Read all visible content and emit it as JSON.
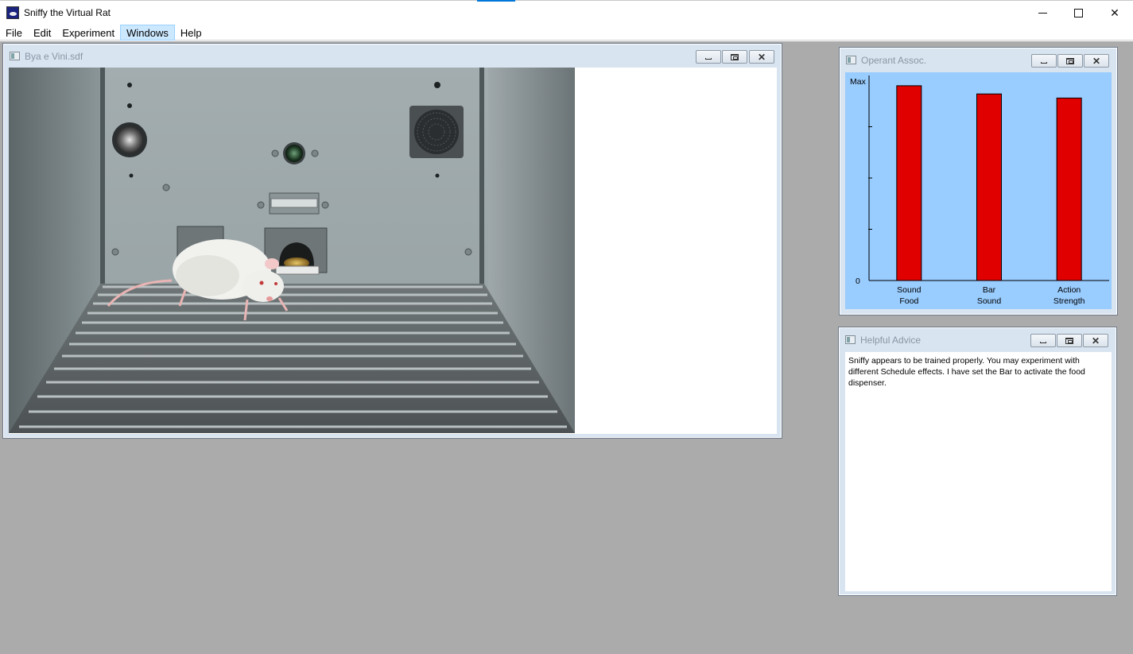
{
  "app": {
    "title": "Sniffy the Virtual Rat",
    "controls": {
      "minimize": "minimize-icon",
      "maximize": "maximize-icon",
      "close": "close-icon"
    }
  },
  "menu": {
    "items": [
      "File",
      "Edit",
      "Experiment",
      "Windows",
      "Help"
    ],
    "active": "Windows"
  },
  "experiment_window": {
    "title": "Bya e Vini.sdf"
  },
  "operant_window": {
    "title": "Operant Assoc."
  },
  "chart_data": {
    "type": "bar",
    "categories": [
      "Sound\nFood",
      "Bar\nSound",
      "Action\nStrength"
    ],
    "category_lines": [
      [
        "Sound",
        "Food"
      ],
      [
        "Bar",
        "Sound"
      ],
      [
        "Action",
        "Strength"
      ]
    ],
    "values": [
      0.95,
      0.91,
      0.89
    ],
    "ytick_labels": {
      "max": "Max",
      "min": "0"
    },
    "ylim": [
      0,
      1
    ],
    "bar_color": "#e00000",
    "background": "#99ccff"
  },
  "advice_window": {
    "title": "Helpful Advice",
    "text": "Sniffy appears to be trained properly. You may experiment with different Schedule effects.  I have set the Bar to activate the food dispenser."
  },
  "colors": {
    "workspace": "#ababab",
    "menu_active": "#cce8ff",
    "chart_bg": "#99ccff",
    "bar": "#e00000"
  }
}
